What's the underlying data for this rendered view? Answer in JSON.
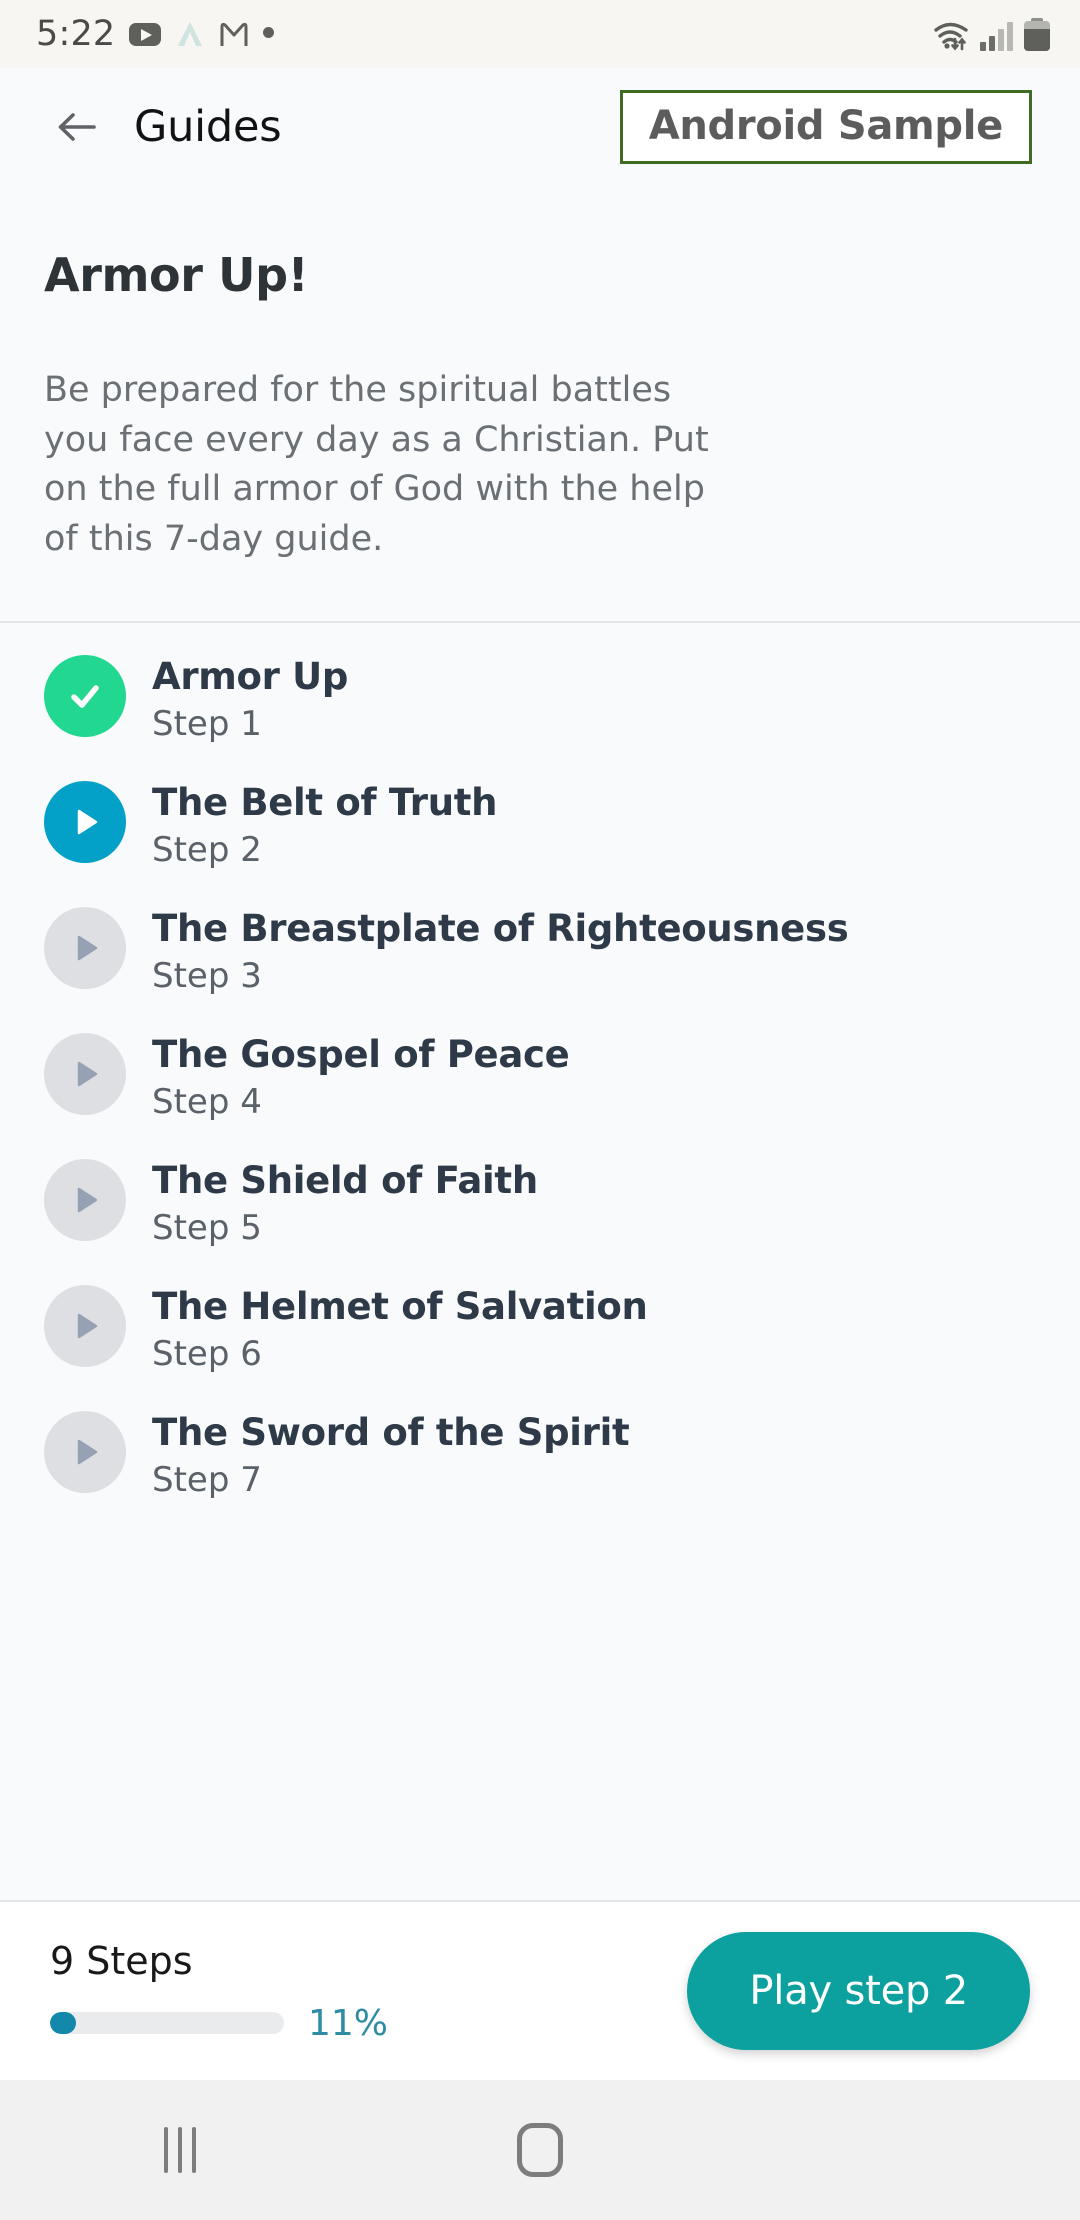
{
  "status_bar": {
    "clock": "5:22",
    "icons_left": [
      "youtube-icon",
      "peak-app-icon",
      "gmail-icon",
      "dot-icon"
    ],
    "icons_right": [
      "wifi-icon",
      "cellular-signal-icon",
      "battery-icon"
    ]
  },
  "app_bar": {
    "back_icon": "back-arrow-icon",
    "title": "Guides",
    "badge_label": "Android Sample",
    "badge_border_color": "#3f6b22"
  },
  "guide": {
    "title": "Armor Up!",
    "description": "Be prepared for the spiritual battles you face every day as a Christian. Put on the full armor of God with the help of this 7-day guide."
  },
  "steps": [
    {
      "name": "Armor Up",
      "sub": "Step 1",
      "state": "done",
      "icon": "check-icon"
    },
    {
      "name": "The Belt of Truth",
      "sub": "Step 2",
      "state": "current",
      "icon": "play-icon"
    },
    {
      "name": "The Breastplate of Righteousness",
      "sub": "Step 3",
      "state": "locked",
      "icon": "play-icon"
    },
    {
      "name": "The Gospel of Peace",
      "sub": "Step 4",
      "state": "locked",
      "icon": "play-icon"
    },
    {
      "name": "The Shield of Faith",
      "sub": "Step 5",
      "state": "locked",
      "icon": "play-icon"
    },
    {
      "name": "The Helmet of Salvation",
      "sub": "Step 6",
      "state": "locked",
      "icon": "play-icon"
    },
    {
      "name": "The Sword of the Spirit",
      "sub": "Step 7",
      "state": "locked",
      "icon": "play-icon"
    }
  ],
  "bottom_bar": {
    "steps_count": "9 Steps",
    "progress_percent_label": "11%",
    "progress_percent_value": 11,
    "play_button_label": "Play step 2",
    "accent_color": "#0ca09e",
    "progress_fill_color": "#1488ab"
  },
  "nav_bar": {
    "recent_label": "recent-apps",
    "home_label": "home",
    "back_label": "back"
  },
  "colors": {
    "done": "#22d78f",
    "current": "#03a0c8",
    "locked": "#dedfe3"
  }
}
